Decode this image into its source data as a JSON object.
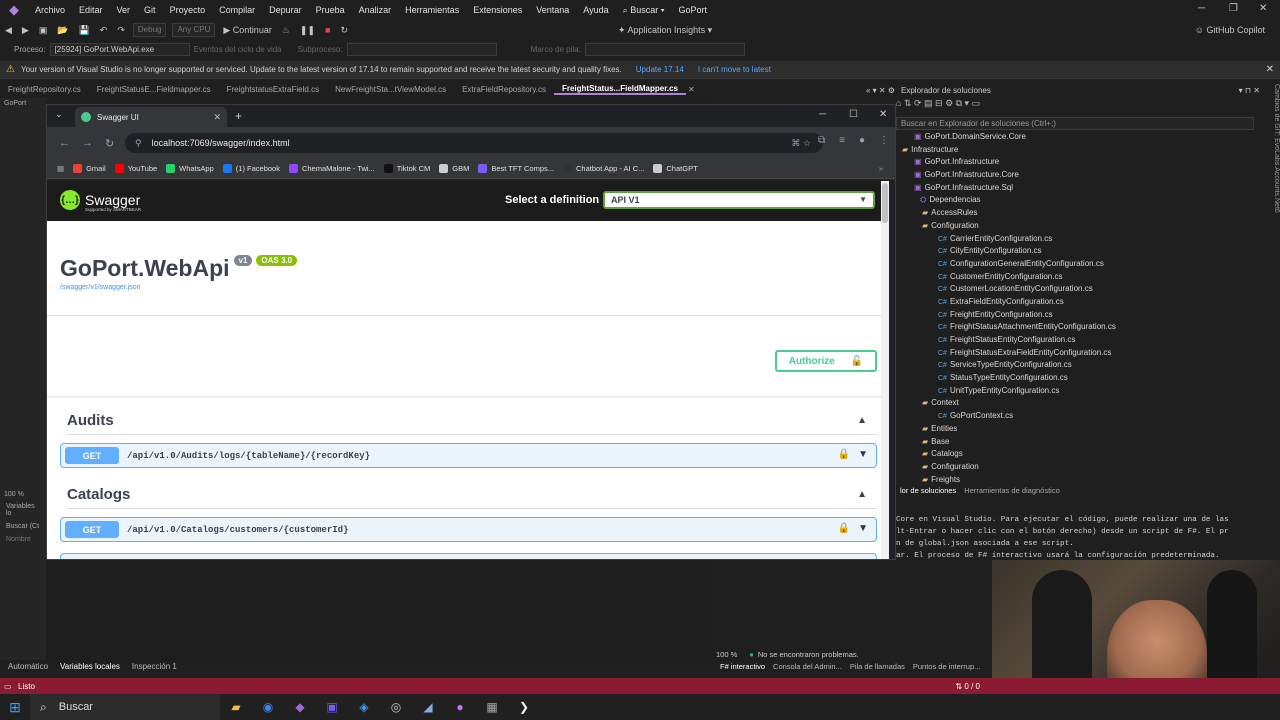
{
  "vs": {
    "menu": [
      "Archivo",
      "Editar",
      "Ver",
      "Git",
      "Proyecto",
      "Compilar",
      "Depurar",
      "Prueba",
      "Analizar",
      "Herramientas",
      "Extensiones",
      "Ventana",
      "Ayuda"
    ],
    "search_label": "Buscar",
    "solution_name": "GoPort",
    "toolbar": {
      "config": "Debug",
      "platform": "Any CPU",
      "continue": "Continuar",
      "app_insights": "Application Insights",
      "copilot": "GitHub Copilot"
    },
    "procbar": {
      "process_label": "Proceso:",
      "process_value": "[25924] GoPort.WebApi.exe",
      "lifecycle": "Eventos del ciclo de vida",
      "subprocess": "Subproceso:",
      "stackframe": "Marco de pila:"
    },
    "info_bar": {
      "message": "Your version of Visual Studio is no longer supported or serviced. Update to the latest version of 17.14 to remain supported and receive the latest security and quality fixes.",
      "update_link": "Update 17.14",
      "dismiss_link": "I can't move to latest"
    },
    "doc_tabs": [
      "FreightRepository.cs",
      "FreightStatusE...Fieldmapper.cs",
      "FreightstatusExtraField.cs",
      "NewFreightSta...tViewModel.cs",
      "ExtraFieldRepository.cs",
      "FreightStatus...FieldMapper.cs"
    ],
    "left_strip": [
      "GoPort",
      "100 %",
      "Variables lo",
      "Buscar (Ct",
      "Nombre"
    ],
    "bottom_tabs_left": [
      "Automático",
      "Variables locales",
      "Inspección 1"
    ],
    "status": {
      "text": "Listo",
      "right": "0 / 0"
    },
    "solution_explorer": {
      "title": "Explorador de soluciones",
      "search_placeholder": "Buscar en Explorador de soluciones (Ctrl+;)",
      "items": [
        {
          "label": "GoPort.DomainService.Core",
          "kind": "proj"
        },
        {
          "label": "Infrastructure",
          "kind": "folder"
        },
        {
          "label": "GoPort.Infrastructure",
          "kind": "proj"
        },
        {
          "label": "GoPort.Infrastructure.Core",
          "kind": "proj"
        },
        {
          "label": "GoPort.Infrastructure.Sql",
          "kind": "proj"
        },
        {
          "label": "Dependencias",
          "kind": "dep"
        },
        {
          "label": "AccessRules",
          "kind": "folder"
        },
        {
          "label": "Configuration",
          "kind": "folder"
        },
        {
          "label": "CarrierEntityConfiguration.cs",
          "kind": "cs"
        },
        {
          "label": "CityEntityConfiguration.cs",
          "kind": "cs"
        },
        {
          "label": "ConfigurationGeneralEntityConfiguration.cs",
          "kind": "cs"
        },
        {
          "label": "CustomerEntityConfiguration.cs",
          "kind": "cs"
        },
        {
          "label": "CustomerLocationEntityConfiguration.cs",
          "kind": "cs"
        },
        {
          "label": "ExtraFieldEntityConfiguration.cs",
          "kind": "cs"
        },
        {
          "label": "FreightEntityConfiguration.cs",
          "kind": "cs"
        },
        {
          "label": "FreightStatusAttachmentEntityConfiguration.cs",
          "kind": "cs"
        },
        {
          "label": "FreightStatusEntityConfiguration.cs",
          "kind": "cs"
        },
        {
          "label": "FreightStatusExtraFieldEntityConfiguration.cs",
          "kind": "cs"
        },
        {
          "label": "ServiceTypeEntityConfiguration.cs",
          "kind": "cs"
        },
        {
          "label": "StatusTypeEntityConfiguration.cs",
          "kind": "cs"
        },
        {
          "label": "UnitTypeEntityConfiguration.cs",
          "kind": "cs"
        },
        {
          "label": "Context",
          "kind": "folder"
        },
        {
          "label": "GoPortContext.cs",
          "kind": "cs"
        },
        {
          "label": "Entities",
          "kind": "folder"
        },
        {
          "label": "Base",
          "kind": "folder"
        },
        {
          "label": "Catalogs",
          "kind": "folder"
        },
        {
          "label": "Configuration",
          "kind": "folder"
        },
        {
          "label": "Freights",
          "kind": "folder"
        }
      ],
      "side_tabs": [
        "lor de soluciones",
        "Herramientas de diagnóstico"
      ],
      "vertical_tab": "Cambios de GIT: EvoLabs.Accounts.Net6"
    },
    "fsi": {
      "lines": [
        "Core en Visual Studio. Para ejecutar el código, puede realizar una de las",
        "lt-Entrar o hacer clic con el botón derecho) desde un script de F#. El pr",
        "n de global.json asociada a ese script.",
        "ar. El proceso de F# interactivo usará la configuración predeterminada."
      ],
      "zoom": "100 %",
      "status": "No se encontraron problemas.",
      "tabs": [
        "F# interactivo",
        "Consola del Admin...",
        "Pila de llamadas",
        "Puntos de interrup..."
      ]
    }
  },
  "browser": {
    "tab_title": "Swagger UI",
    "url": "localhost:7069/swagger/index.html",
    "bookmarks": [
      {
        "label": "Gmail",
        "color": "#ea4335"
      },
      {
        "label": "YouTube",
        "color": "#ff0000"
      },
      {
        "label": "WhatsApp",
        "color": "#25d366"
      },
      {
        "label": "(1) Facebook",
        "color": "#1877f2"
      },
      {
        "label": "ChemaMalone - Twi...",
        "color": "#9146ff"
      },
      {
        "label": "Tiktok CM",
        "color": "#111111"
      },
      {
        "label": "GBM",
        "color": "#cccccc"
      },
      {
        "label": "Best TFT Comps...",
        "color": "#7a5af8"
      },
      {
        "label": "Chatbot App - AI C...",
        "color": "#333333"
      },
      {
        "label": "ChatGPT",
        "color": "#cccccc"
      }
    ]
  },
  "swagger": {
    "logo_text": "Swagger",
    "logo_sub": "Supported by SMARTBEAR",
    "select_label": "Select a definition",
    "selected_definition": "API V1",
    "title": "GoPort.WebApi",
    "version_badge": "v1",
    "oas_badge": "OAS 3.0",
    "spec_link": "/swagger/v1/swagger.json",
    "authorize_label": "Authorize",
    "sections": [
      {
        "name": "Audits",
        "ops": [
          {
            "method": "GET",
            "path": "/api/v1.0/Audits/logs/{tableName}/{recordKey}"
          }
        ]
      },
      {
        "name": "Catalogs",
        "ops": [
          {
            "method": "GET",
            "path": "/api/v1.0/Catalogs/customers/{customerId}"
          }
        ]
      }
    ]
  },
  "taskbar": {
    "search_label": "Buscar"
  },
  "colors": {
    "status_bar": "#8b1a33",
    "get_method": "#61affe",
    "swagger_green": "#49cc90",
    "oas_green": "#89bf04"
  }
}
